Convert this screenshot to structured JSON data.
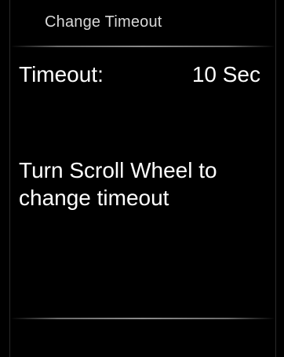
{
  "header": {
    "title": "Change Timeout"
  },
  "setting": {
    "label": "Timeout:",
    "value": "10 Sec"
  },
  "instruction": {
    "line1": "Turn Scroll Wheel to",
    "line2": "change timeout"
  },
  "colors": {
    "background": "#000000",
    "text": "#ffffff",
    "header_text": "#d8d8d8",
    "divider": "#8a8a8a"
  }
}
